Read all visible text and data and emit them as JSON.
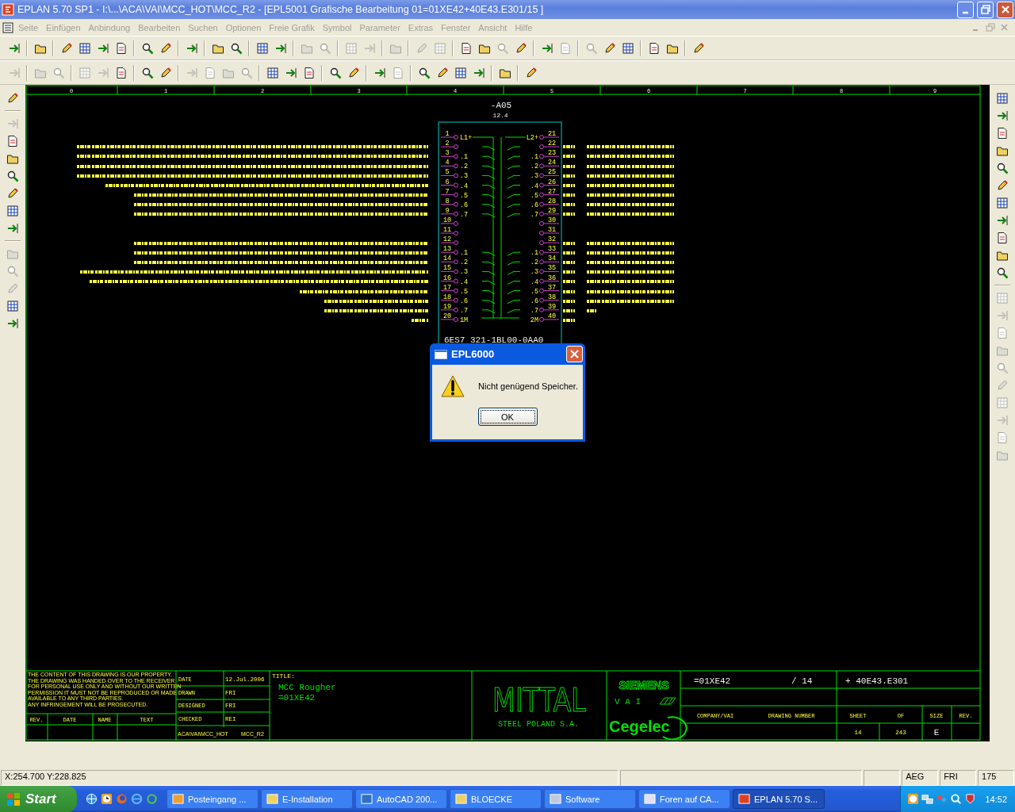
{
  "window": {
    "title": "EPLAN 5.70 SP1 - I:\\...\\ACA\\VAI\\MCC_HOT\\MCC_R2 - [EPL5001 Grafische Bearbeitung 01=01XE42+40E43.E301/15     ]"
  },
  "menu": [
    {
      "label": "Seite",
      "disabled": true
    },
    {
      "label": "Einfügen",
      "disabled": true
    },
    {
      "label": "Anbindung",
      "disabled": true
    },
    {
      "label": "Bearbeiten",
      "disabled": true
    },
    {
      "label": "Suchen",
      "disabled": true
    },
    {
      "label": "Optionen",
      "disabled": true
    },
    {
      "label": "Freie Grafik",
      "disabled": true
    },
    {
      "label": "Symbol",
      "disabled": true
    },
    {
      "label": "Parameter",
      "disabled": true
    },
    {
      "label": "Extras",
      "disabled": true
    },
    {
      "label": "Fenster",
      "disabled": true
    },
    {
      "label": "Ansicht",
      "disabled": true
    },
    {
      "label": "Hilfe",
      "disabled": true
    }
  ],
  "toolbar_rows": [
    [
      {
        "kind": "button",
        "disabled": false
      },
      {
        "kind": "separator"
      },
      {
        "kind": "button",
        "disabled": false
      },
      {
        "kind": "separator"
      },
      {
        "kind": "button",
        "disabled": false
      },
      {
        "kind": "button",
        "disabled": false
      },
      {
        "kind": "button",
        "disabled": false
      },
      {
        "kind": "button",
        "disabled": false
      },
      {
        "kind": "separator"
      },
      {
        "kind": "button",
        "disabled": false
      },
      {
        "kind": "button",
        "disabled": false
      },
      {
        "kind": "separator"
      },
      {
        "kind": "button",
        "disabled": false
      },
      {
        "kind": "separator"
      },
      {
        "kind": "button",
        "disabled": false
      },
      {
        "kind": "button",
        "disabled": false
      },
      {
        "kind": "separator"
      },
      {
        "kind": "button",
        "disabled": false
      },
      {
        "kind": "button",
        "disabled": false
      },
      {
        "kind": "separator"
      },
      {
        "kind": "button",
        "disabled": true
      },
      {
        "kind": "button",
        "disabled": true
      },
      {
        "kind": "separator"
      },
      {
        "kind": "button",
        "disabled": true
      },
      {
        "kind": "button",
        "disabled": true
      },
      {
        "kind": "separator"
      },
      {
        "kind": "button",
        "disabled": true
      },
      {
        "kind": "separator"
      },
      {
        "kind": "button",
        "disabled": true
      },
      {
        "kind": "button",
        "disabled": true
      },
      {
        "kind": "separator"
      },
      {
        "kind": "button",
        "disabled": false
      },
      {
        "kind": "button",
        "disabled": false
      },
      {
        "kind": "button",
        "disabled": true
      },
      {
        "kind": "button",
        "disabled": false
      },
      {
        "kind": "separator"
      },
      {
        "kind": "button",
        "disabled": false
      },
      {
        "kind": "button",
        "disabled": true
      },
      {
        "kind": "separator"
      },
      {
        "kind": "button",
        "disabled": true
      },
      {
        "kind": "button",
        "disabled": false
      },
      {
        "kind": "button",
        "disabled": false
      },
      {
        "kind": "separator"
      },
      {
        "kind": "button",
        "disabled": false
      },
      {
        "kind": "button",
        "disabled": false
      },
      {
        "kind": "separator"
      },
      {
        "kind": "button",
        "disabled": false
      }
    ],
    [
      {
        "kind": "button",
        "disabled": true
      },
      {
        "kind": "separator"
      },
      {
        "kind": "button",
        "disabled": true
      },
      {
        "kind": "button",
        "disabled": true
      },
      {
        "kind": "separator"
      },
      {
        "kind": "button",
        "disabled": true
      },
      {
        "kind": "button",
        "disabled": true
      },
      {
        "kind": "button",
        "disabled": false
      },
      {
        "kind": "separator"
      },
      {
        "kind": "button",
        "disabled": false
      },
      {
        "kind": "button",
        "disabled": false
      },
      {
        "kind": "separator"
      },
      {
        "kind": "button",
        "disabled": true
      },
      {
        "kind": "button",
        "disabled": true
      },
      {
        "kind": "button",
        "disabled": true
      },
      {
        "kind": "button",
        "disabled": true
      },
      {
        "kind": "separator"
      },
      {
        "kind": "button",
        "disabled": false
      },
      {
        "kind": "button",
        "disabled": false
      },
      {
        "kind": "button",
        "disabled": false
      },
      {
        "kind": "separator"
      },
      {
        "kind": "button",
        "disabled": false
      },
      {
        "kind": "button",
        "disabled": false
      },
      {
        "kind": "separator"
      },
      {
        "kind": "button",
        "disabled": false
      },
      {
        "kind": "button",
        "disabled": true
      },
      {
        "kind": "separator"
      },
      {
        "kind": "button",
        "disabled": false
      },
      {
        "kind": "button",
        "disabled": false
      },
      {
        "kind": "button",
        "disabled": false
      },
      {
        "kind": "button",
        "disabled": false
      },
      {
        "kind": "separator"
      },
      {
        "kind": "button",
        "disabled": false
      },
      {
        "kind": "separator"
      },
      {
        "kind": "button",
        "disabled": false
      }
    ]
  ],
  "left_toolbar": [
    {
      "kind": "button",
      "disabled": false
    },
    {
      "kind": "separator"
    },
    {
      "kind": "button",
      "disabled": true
    },
    {
      "kind": "button",
      "disabled": false
    },
    {
      "kind": "button",
      "disabled": false
    },
    {
      "kind": "button",
      "disabled": false
    },
    {
      "kind": "button",
      "disabled": false
    },
    {
      "kind": "button",
      "disabled": false
    },
    {
      "kind": "button",
      "disabled": false
    },
    {
      "kind": "separator"
    },
    {
      "kind": "button",
      "disabled": true
    },
    {
      "kind": "button",
      "disabled": true
    },
    {
      "kind": "button",
      "disabled": true
    },
    {
      "kind": "button",
      "disabled": false
    },
    {
      "kind": "button",
      "disabled": false
    }
  ],
  "right_toolbar": [
    {
      "kind": "button",
      "disabled": false
    },
    {
      "kind": "button",
      "disabled": false
    },
    {
      "kind": "button",
      "disabled": false
    },
    {
      "kind": "button",
      "disabled": false
    },
    {
      "kind": "button",
      "disabled": false
    },
    {
      "kind": "button",
      "disabled": false
    },
    {
      "kind": "button",
      "disabled": false
    },
    {
      "kind": "button",
      "disabled": false
    },
    {
      "kind": "button",
      "disabled": false
    },
    {
      "kind": "button",
      "disabled": false
    },
    {
      "kind": "button",
      "disabled": false
    },
    {
      "kind": "separator"
    },
    {
      "kind": "button",
      "disabled": true
    },
    {
      "kind": "button",
      "disabled": true
    },
    {
      "kind": "button",
      "disabled": true
    },
    {
      "kind": "button",
      "disabled": true
    },
    {
      "kind": "button",
      "disabled": true
    },
    {
      "kind": "button",
      "disabled": true
    },
    {
      "kind": "button",
      "disabled": true
    },
    {
      "kind": "button",
      "disabled": true
    },
    {
      "kind": "button",
      "disabled": true
    },
    {
      "kind": "button",
      "disabled": true
    }
  ],
  "drawing": {
    "columns": [
      "0",
      "1",
      "2",
      "3",
      "4",
      "5",
      "6",
      "7",
      "8",
      "9"
    ],
    "device_tag": "-A05",
    "device_ref": "12.4",
    "part_number": "6ES7 321-1BL00-0AA0",
    "left_terminals": [
      {
        "number": "1",
        "label": "L1+"
      },
      {
        "number": "2"
      },
      {
        "number": "3",
        "label": ".1"
      },
      {
        "number": "4",
        "label": ".2"
      },
      {
        "number": "5",
        "label": ".3"
      },
      {
        "number": "6",
        "label": ".4"
      },
      {
        "number": "7",
        "label": ".5"
      },
      {
        "number": "8",
        "label": ".6"
      },
      {
        "number": "9",
        "label": ".7"
      },
      {
        "number": "10"
      },
      {
        "number": "11"
      },
      {
        "number": "12"
      },
      {
        "number": "13",
        "label": ".1"
      },
      {
        "number": "14",
        "label": ".2"
      },
      {
        "number": "15",
        "label": ".3"
      },
      {
        "number": "16",
        "label": ".4"
      },
      {
        "number": "17",
        "label": ".5"
      },
      {
        "number": "18",
        "label": ".6"
      },
      {
        "number": "19",
        "label": ".7"
      },
      {
        "number": "20",
        "label": "1M"
      }
    ],
    "right_terminals": [
      {
        "number": "21",
        "label": "L2+"
      },
      {
        "number": "22"
      },
      {
        "number": "23",
        "label": ".1"
      },
      {
        "number": "24",
        "label": ".2"
      },
      {
        "number": "25",
        "label": ".3"
      },
      {
        "number": "26",
        "label": ".4"
      },
      {
        "number": "27",
        "label": ".5"
      },
      {
        "number": "28",
        "label": ".6"
      },
      {
        "number": "29",
        "label": ".7"
      },
      {
        "number": "30"
      },
      {
        "number": "31"
      },
      {
        "number": "32"
      },
      {
        "number": "33",
        "label": ".1"
      },
      {
        "number": "34",
        "label": ".2"
      },
      {
        "number": "35",
        "label": ".3"
      },
      {
        "number": "36",
        "label": ".4"
      },
      {
        "number": "37",
        "label": ".5"
      },
      {
        "number": "38",
        "label": ".6"
      },
      {
        "number": "39",
        "label": ".7"
      },
      {
        "number": "40",
        "label": "2M"
      }
    ]
  },
  "title_block": {
    "disclaimer_lines": [
      "THE CONTENT OF THIS DRAWING IS OUR PROPERTY.",
      "THE DRAWING WAS HANDED OVER TO THE RECEIVER",
      "FOR PERSONAL USE ONLY AND WITHOUT OUR WRITTEN",
      "PERMISSION IT MUST NOT BE REPRODUCED OR MADE",
      "AVAILABLE TO ANY THIRD PARTIES.",
      "ANY INFRINGEMENT WILL BE PROSECUTED."
    ],
    "rev_headers": [
      "REV.",
      "DATE",
      "NAME",
      "TEXT"
    ],
    "approvals": [
      {
        "label": "DATE",
        "value": "12.Jul.2006"
      },
      {
        "label": "DRAWN",
        "value": "FRI"
      },
      {
        "label": "DESIGNED",
        "value": "FRI"
      },
      {
        "label": "CHECKED",
        "value": "REI"
      }
    ],
    "path": "ACA\\VAI\\MCC_HOT",
    "project": "MCC_R2",
    "title_label": "TITLE:",
    "title_lines": [
      "MCC Rougher",
      "=01XE42"
    ],
    "customer": "MITTAL",
    "customer_sub": "STEEL POLAND S.A.",
    "partner": "SIEMENS",
    "partner_sub": "V A I",
    "contractor": "Cegelec",
    "function": "=01XE42",
    "page": "/ 14",
    "location": "+ 40E43.E301",
    "field_headers": [
      "COMPANY/VAI",
      "DRAWING NUMBER",
      "SHEET",
      "OF",
      "SIZE",
      "REV."
    ],
    "sheet": "14",
    "of": "243",
    "size": "E"
  },
  "dialog": {
    "title": "EPL6000",
    "message": "Nicht genügend Speicher.",
    "button": "OK"
  },
  "status_bar": {
    "coordinates": "X:254.700 Y:228.825",
    "fields": [
      "AEG",
      "FRI",
      "175"
    ]
  },
  "taskbar": {
    "start": "Start",
    "tasks": [
      {
        "label": "Posteingang ...",
        "selected": false
      },
      {
        "label": "E-Installation",
        "selected": false
      },
      {
        "label": "AutoCAD 200...",
        "selected": false
      },
      {
        "label": "BLOECKE",
        "selected": false
      },
      {
        "label": "Software",
        "selected": false
      },
      {
        "label": "Foren auf CA...",
        "selected": false
      },
      {
        "label": "EPLAN 5.70 S...",
        "selected": true
      }
    ],
    "clock": "14:52"
  }
}
